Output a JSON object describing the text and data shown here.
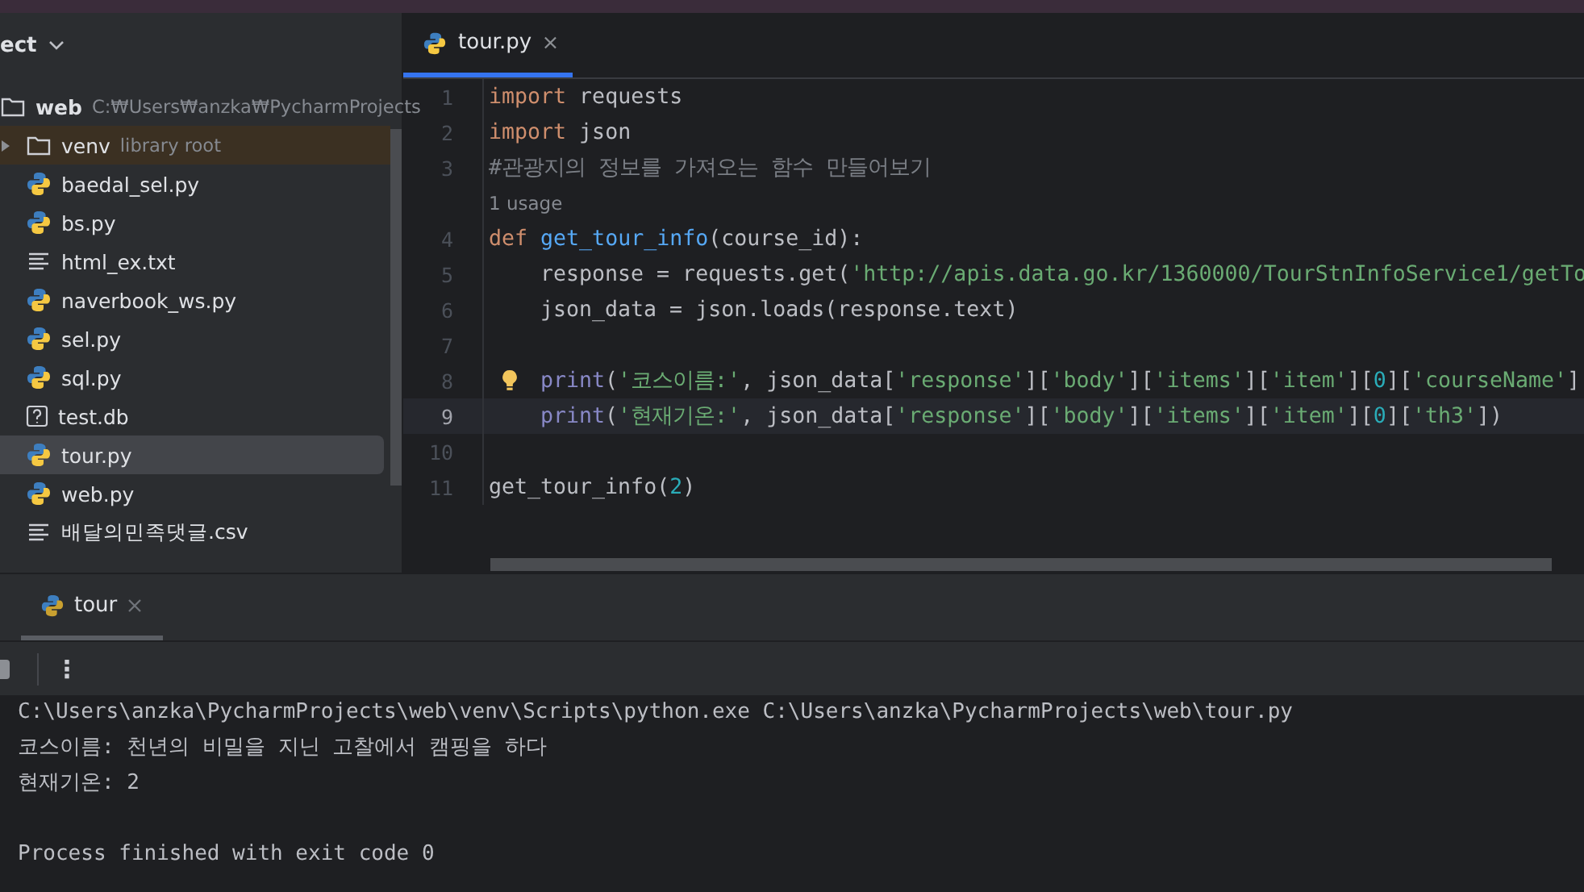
{
  "project_panel": {
    "title": "ect",
    "tree": [
      {
        "label": "web",
        "hint": "C:₩Users₩anzka₩PycharmProjects",
        "kind": "folder",
        "selected": false,
        "expanded": true,
        "children": [
          {
            "label": "venv",
            "hint": "library root",
            "kind": "library",
            "selected": false,
            "expanded": false
          },
          {
            "label": "baedal_sel.py",
            "kind": "python",
            "selected": false
          },
          {
            "label": "bs.py",
            "kind": "python",
            "selected": false
          },
          {
            "label": "html_ex.txt",
            "kind": "text",
            "selected": false
          },
          {
            "label": "naverbook_ws.py",
            "kind": "python",
            "selected": false
          },
          {
            "label": "sel.py",
            "kind": "python",
            "selected": false
          },
          {
            "label": "sql.py",
            "kind": "python",
            "selected": false
          },
          {
            "label": "test.db",
            "kind": "unknown",
            "selected": false
          },
          {
            "label": "tour.py",
            "kind": "python",
            "selected": true
          },
          {
            "label": "web.py",
            "kind": "python",
            "selected": false
          },
          {
            "label": "배달의민족댓글.csv",
            "kind": "text",
            "selected": false
          }
        ]
      }
    ]
  },
  "editor": {
    "tabs": [
      {
        "label": "tour.py",
        "selected": true
      }
    ],
    "lines": [
      {
        "kind": "code",
        "number": "1",
        "current": false,
        "bulb": false,
        "indented": false,
        "tokens": [
          {
            "text": "import",
            "kind": "keyword"
          },
          {
            "text": " requests",
            "kind": "plain"
          }
        ]
      },
      {
        "kind": "code",
        "number": "2",
        "current": false,
        "bulb": false,
        "indented": false,
        "tokens": [
          {
            "text": "import",
            "kind": "keyword"
          },
          {
            "text": " json",
            "kind": "plain"
          }
        ]
      },
      {
        "kind": "code",
        "number": "3",
        "current": false,
        "bulb": false,
        "indented": false,
        "tokens": [
          {
            "text": "#관광지의 정보를 가져오는 함수 만들어보기",
            "kind": "comment"
          }
        ]
      },
      {
        "kind": "hint",
        "text": "1 usage"
      },
      {
        "kind": "code",
        "number": "4",
        "current": false,
        "bulb": false,
        "indented": false,
        "tokens": [
          {
            "text": "def",
            "kind": "keyword"
          },
          {
            "text": " get_tour_info",
            "kind": "function"
          },
          {
            "text": "(course_id):",
            "kind": "plain"
          }
        ]
      },
      {
        "kind": "code",
        "number": "5",
        "current": false,
        "bulb": false,
        "indented": true,
        "tokens": [
          {
            "text": "response = requests.get(",
            "kind": "plain"
          },
          {
            "text": "'http://apis.data.go.kr/1360000/TourStnInfoService1/getTo",
            "kind": "string"
          }
        ]
      },
      {
        "kind": "code",
        "number": "6",
        "current": false,
        "bulb": false,
        "indented": true,
        "tokens": [
          {
            "text": "json_data = json.loads(response.text)",
            "kind": "plain"
          }
        ]
      },
      {
        "kind": "code",
        "number": "7",
        "current": false,
        "bulb": false,
        "indented": false
      },
      {
        "kind": "code",
        "number": "8",
        "current": false,
        "bulb": true,
        "indented": true,
        "tokens": [
          {
            "text": "print",
            "kind": "builtin"
          },
          {
            "text": "(",
            "kind": "plain"
          },
          {
            "text": "'코스이름:'",
            "kind": "string"
          },
          {
            "text": ", json_data[",
            "kind": "plain"
          },
          {
            "text": "'response'",
            "kind": "string"
          },
          {
            "text": "][",
            "kind": "plain"
          },
          {
            "text": "'body'",
            "kind": "string"
          },
          {
            "text": "][",
            "kind": "plain"
          },
          {
            "text": "'items'",
            "kind": "string"
          },
          {
            "text": "][",
            "kind": "plain"
          },
          {
            "text": "'item'",
            "kind": "string"
          },
          {
            "text": "][",
            "kind": "plain"
          },
          {
            "text": "0",
            "kind": "number"
          },
          {
            "text": "][",
            "kind": "plain"
          },
          {
            "text": "'courseName'",
            "kind": "string"
          },
          {
            "text": "]",
            "kind": "plain"
          }
        ]
      },
      {
        "kind": "code",
        "number": "9",
        "current": true,
        "bulb": false,
        "indented": true,
        "tokens": [
          {
            "text": "print",
            "kind": "builtin"
          },
          {
            "text": "(",
            "kind": "plain"
          },
          {
            "text": "'현재기온:'",
            "kind": "string"
          },
          {
            "text": ", json_data[",
            "kind": "plain"
          },
          {
            "text": "'response'",
            "kind": "string"
          },
          {
            "text": "][",
            "kind": "plain"
          },
          {
            "text": "'body'",
            "kind": "string"
          },
          {
            "text": "][",
            "kind": "plain"
          },
          {
            "text": "'items'",
            "kind": "string"
          },
          {
            "text": "][",
            "kind": "plain"
          },
          {
            "text": "'item'",
            "kind": "string"
          },
          {
            "text": "][",
            "kind": "plain"
          },
          {
            "text": "0",
            "kind": "number"
          },
          {
            "text": "][",
            "kind": "plain"
          },
          {
            "text": "'th3'",
            "kind": "string"
          },
          {
            "text": "])",
            "kind": "plain"
          }
        ]
      },
      {
        "kind": "code",
        "number": "10",
        "current": false,
        "bulb": false,
        "indented": false
      },
      {
        "kind": "code",
        "number": "11",
        "current": false,
        "bulb": false,
        "indented": false,
        "tokens": [
          {
            "text": "get_tour_info(",
            "kind": "plain"
          },
          {
            "text": "2",
            "kind": "number"
          },
          {
            "text": ")",
            "kind": "plain"
          }
        ]
      }
    ]
  },
  "run_panel": {
    "tabs": [
      {
        "label": "tour",
        "selected": true
      }
    ],
    "menu": "⋮",
    "output": [
      "C:\\Users\\anzka\\PycharmProjects\\web\\venv\\Scripts\\python.exe C:\\Users\\anzka\\PycharmProjects\\web\\tour.py",
      "코스이름: 천년의 비밀을 지닌 고찰에서 캠핑을 하다",
      "현재기온: 2"
    ],
    "exit_message": "Process finished with exit code 0"
  }
}
